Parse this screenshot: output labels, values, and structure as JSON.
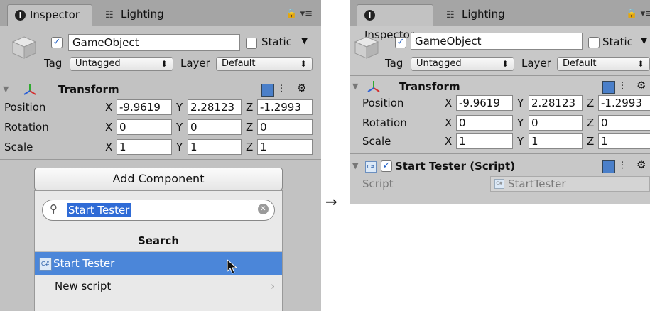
{
  "before": {
    "tabs": [
      {
        "label": "Inspector"
      },
      {
        "label": "Lighting"
      }
    ],
    "object": {
      "name": "GameObject",
      "static_label": "Static",
      "tag_label": "Tag",
      "tag_value": "Untagged",
      "layer_label": "Layer",
      "layer_value": "Default"
    },
    "transform": {
      "title": "Transform",
      "rows": [
        {
          "label": "Position",
          "x": "-9.9619",
          "y": "2.28123",
          "z": "-1.2993"
        },
        {
          "label": "Rotation",
          "x": "0",
          "y": "0",
          "z": "0"
        },
        {
          "label": "Scale",
          "x": "1",
          "y": "1",
          "z": "1"
        }
      ]
    },
    "add_component": {
      "button_label": "Add Component",
      "search_value": "Start Tester",
      "section_label": "Search",
      "items": [
        {
          "label": "Start Tester",
          "icon": "C#"
        },
        {
          "label": "New script"
        }
      ]
    }
  },
  "arrow": "→",
  "after": {
    "tabs": [
      {
        "label": "Inspector"
      },
      {
        "label": "Lighting"
      }
    ],
    "object": {
      "name": "GameObject",
      "static_label": "Static",
      "tag_label": "Tag",
      "tag_value": "Untagged",
      "layer_label": "Layer",
      "layer_value": "Default"
    },
    "transform": {
      "title": "Transform",
      "rows": [
        {
          "label": "Position",
          "x": "-9.9619",
          "y": "2.28123",
          "z": "-1.2993"
        },
        {
          "label": "Rotation",
          "x": "0",
          "y": "0",
          "z": "0"
        },
        {
          "label": "Scale",
          "x": "1",
          "y": "1",
          "z": "1"
        }
      ]
    },
    "script_component": {
      "title": "Start Tester (Script)",
      "icon": "C#",
      "script_label": "Script",
      "script_value": "StartTester"
    }
  },
  "axis_labels": {
    "x": "X",
    "y": "Y",
    "z": "Z"
  },
  "colors": {
    "selection": "#4b86d9",
    "panel": "#c2c2c2",
    "accent_check": "#2563c7"
  }
}
